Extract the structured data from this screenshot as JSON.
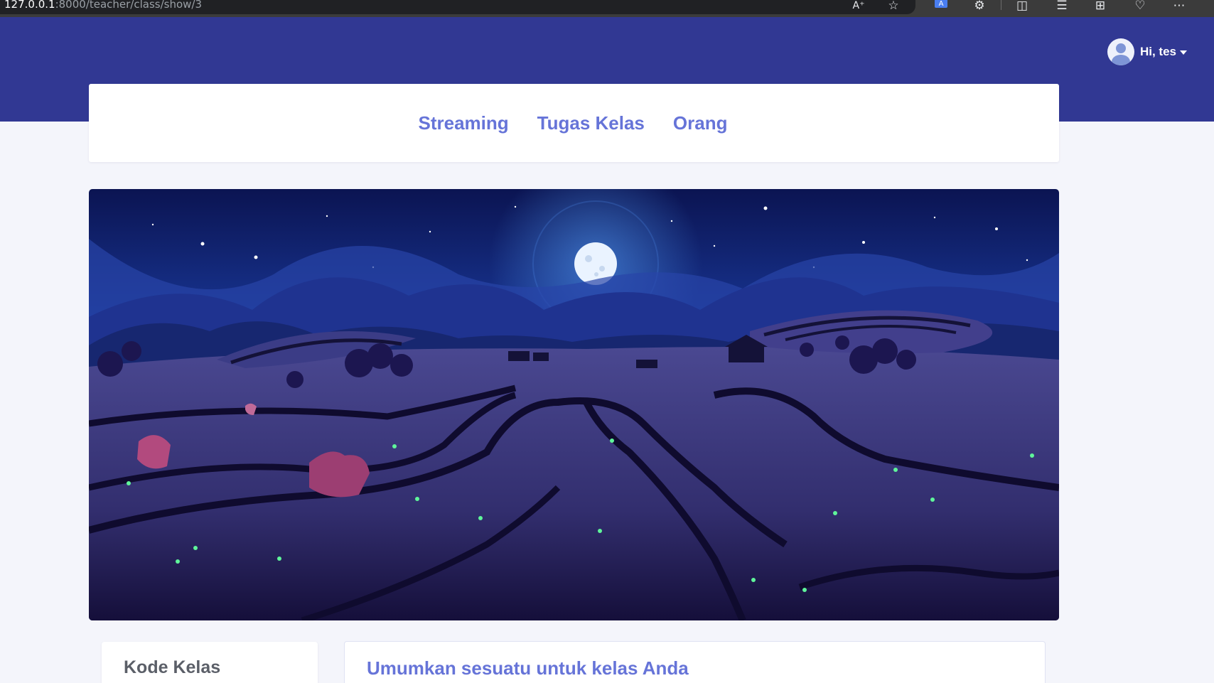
{
  "browser": {
    "url_host": "127.0.0.1",
    "url_path": ":8000/teacher/class/show/3",
    "toolbar_icons": [
      "read-aloud-icon",
      "favorite-star-icon",
      "translate-icon",
      "extensions-icon",
      "split-screen-icon",
      "favorites-list-icon",
      "collections-icon",
      "performance-icon",
      "more-icon"
    ]
  },
  "header": {
    "user_greeting": "Hi, tes",
    "avatar_icon": "user-avatar-icon",
    "background_color": "#313893"
  },
  "nav": {
    "tabs": [
      {
        "label": "Streaming"
      },
      {
        "label": "Tugas Kelas"
      },
      {
        "label": "Orang"
      }
    ],
    "link_color": "#6674d8"
  },
  "banner": {
    "image": "night rice terraces illustration"
  },
  "class_code_card": {
    "title": "Kode Kelas"
  },
  "announcement": {
    "prompt": "Umumkan sesuatu untuk kelas Anda"
  }
}
